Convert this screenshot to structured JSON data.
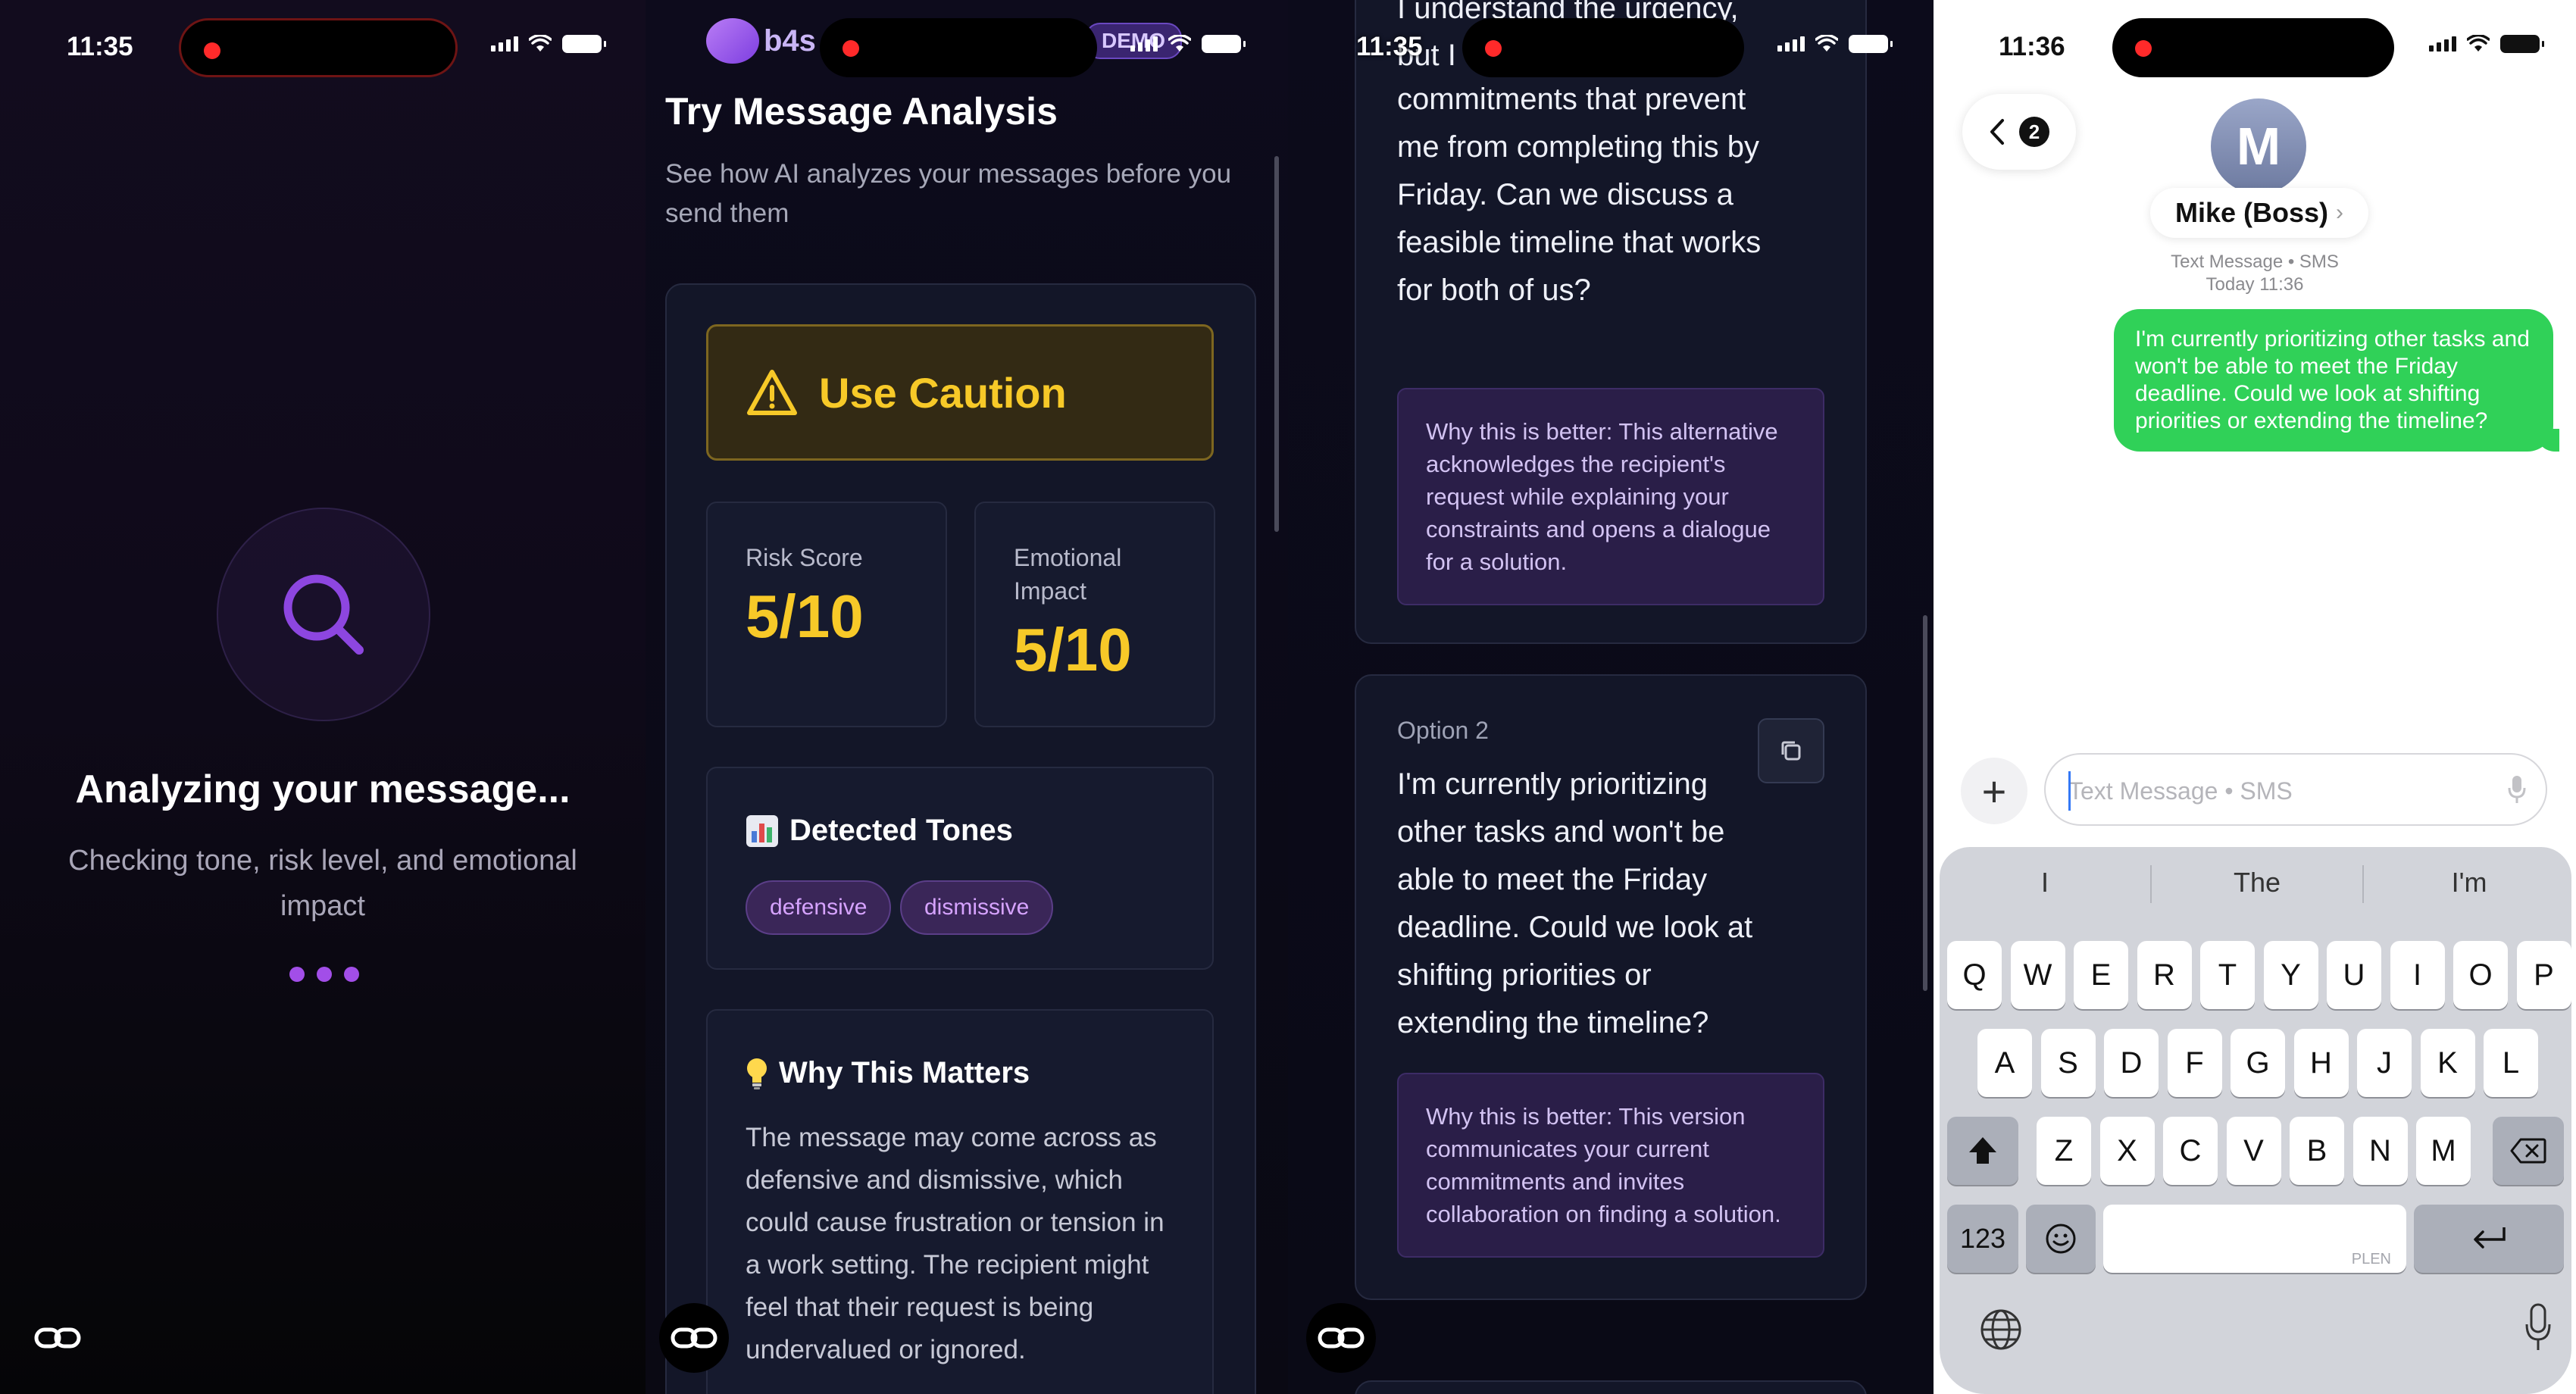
{
  "panel1": {
    "status_time": "11:35",
    "title": "Analyzing your message...",
    "subtitle": "Checking tone, risk level, and emotional impact",
    "icons": {
      "search": "search-icon",
      "link": "link-icon"
    },
    "accent": "#a24ee8"
  },
  "panel2": {
    "status_time": "11:35",
    "brand": "b4s",
    "badge": "DEMO",
    "title": "Try Message Analysis",
    "subtitle": "See how AI analyzes your messages before you send them",
    "caution": "Use Caution",
    "risk_label": "Risk Score",
    "risk_value": "5/10",
    "emotional_label": "Emotional Impact",
    "emotional_value": "5/10",
    "tones_heading": "Detected Tones",
    "tones": [
      "defensive",
      "dismissive"
    ],
    "why_heading": "Why This Matters",
    "why_text": "The message may come across as defensive and dismissive, which could cause frustration or tension in a work setting. The recipient might feel that their request is being undervalued or ignored.",
    "colors": {
      "caution": "#f7c928",
      "tone_text": "#d6a3ff"
    }
  },
  "panel3": {
    "status_time": "11:35",
    "option1_partial_first": "I understand the urgency,",
    "option1_partial_second": "but I",
    "option1_text": "commitments that prevent me from completing this by Friday. Can we discuss a feasible timeline that works for both of us?",
    "option1_why": "Why this is better: This alternative acknowledges the recipient's request while explaining your constraints and opens a dialogue for a solution.",
    "option2_label": "Option 2",
    "option2_text": "I'm currently prioritizing other tasks and won't be able to meet the Friday deadline. Could we look at shifting priorities or extending the timeline?",
    "option2_why": "Why this is better: This version communicates your current commitments and invites collaboration on finding a solution."
  },
  "panel4": {
    "status_time": "11:36",
    "back_count": "2",
    "avatar_letter": "M",
    "contact_name": "Mike (Boss)",
    "meta_line1": "Text Message • SMS",
    "meta_line2": "Today 11:36",
    "message": "I'm currently prioritizing other tasks and won't be able to meet the Friday deadline. Could we look at shifting priorities or extending the timeline?",
    "input_placeholder": "Text Message • SMS",
    "suggestions": [
      "I",
      "The",
      "I'm"
    ],
    "row1": [
      "Q",
      "W",
      "E",
      "R",
      "T",
      "Y",
      "U",
      "I",
      "O",
      "P"
    ],
    "row2": [
      "A",
      "S",
      "D",
      "F",
      "G",
      "H",
      "J",
      "K",
      "L"
    ],
    "row3": [
      "Z",
      "X",
      "C",
      "V",
      "B",
      "N",
      "M"
    ],
    "numbers_key": "123",
    "space_hint": "PLEN",
    "colors": {
      "bubble": "#30d158"
    }
  }
}
